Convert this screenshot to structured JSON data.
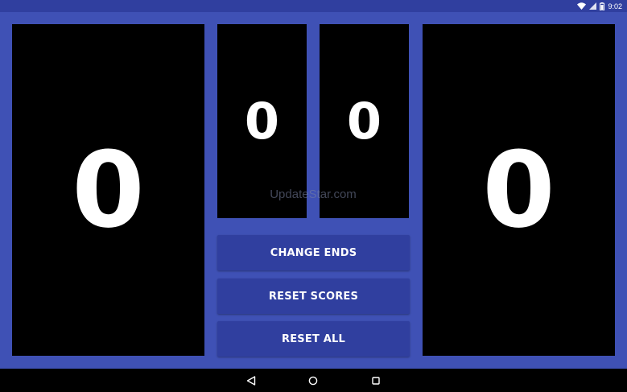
{
  "status_bar": {
    "time": "9:02",
    "icons": [
      "wifi-icon",
      "cell-signal-icon",
      "battery-icon"
    ]
  },
  "scoreboard": {
    "left_score": "0",
    "right_score": "0",
    "left_sets": "0",
    "right_sets": "0"
  },
  "watermark": "UpdateStar.com",
  "buttons": {
    "change_ends": "CHANGE ENDS",
    "reset_scores": "RESET SCORES",
    "reset_all": "RESET ALL"
  },
  "nav_bar": {
    "icons": [
      "back-icon",
      "home-icon",
      "recents-icon"
    ]
  },
  "colors": {
    "background": "#3f51b5",
    "status_bar": "#303f9f",
    "button": "#303f9f",
    "panel": "#000000",
    "text": "#ffffff"
  }
}
